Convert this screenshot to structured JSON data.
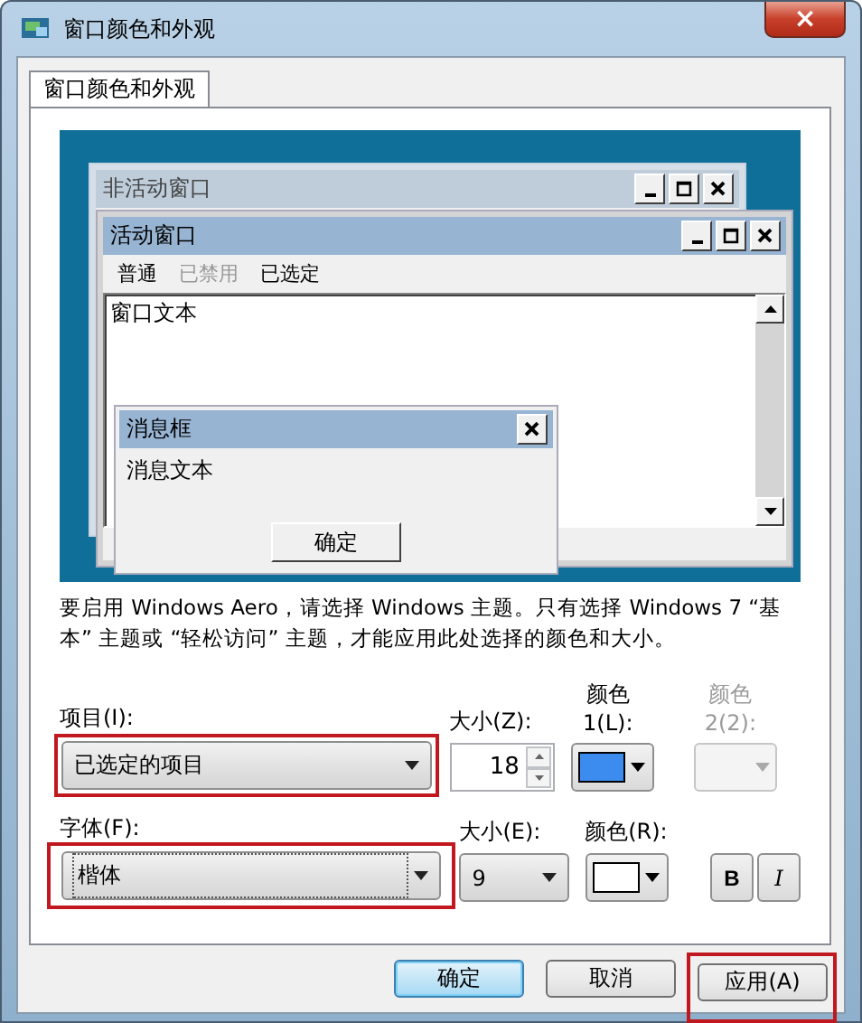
{
  "window": {
    "title": "窗口颜色和外观",
    "close": "×"
  },
  "tabs": [
    {
      "label": "窗口颜色和外观",
      "selected": true
    }
  ],
  "preview": {
    "inactive_window": {
      "title": "非活动窗口"
    },
    "active_window": {
      "title": "活动窗口",
      "menu": [
        {
          "label": "普通",
          "kind": "normal"
        },
        {
          "label": "已禁用",
          "kind": "disabled"
        },
        {
          "label": "已选定",
          "kind": "selected"
        }
      ],
      "text": "窗口文本"
    },
    "message_box": {
      "title": "消息框",
      "text": "消息文本",
      "button": "确定"
    }
  },
  "notice": "要启用 Windows Aero，请选择 Windows 主题。只有选择 Windows 7 “基本” 主题或 “轻松访问” 主题，才能应用此处选择的颜色和大小。",
  "item_row": {
    "item_label": "项目(I):",
    "item_value": "已选定的项目",
    "item_highlighted": true,
    "size_label": "大小(Z):",
    "size_value": "18",
    "color1_label": "颜色 1(L):",
    "color1_swatch": {
      "color": "#3c8cf0"
    },
    "color2_label": "颜色 2(2):",
    "color2_disabled": true
  },
  "font_row": {
    "font_label": "字体(F):",
    "font_value": "楷体",
    "font_highlighted": true,
    "size_label": "大小(E):",
    "size_value": "9",
    "color_label": "颜色(R):",
    "color_swatch": {
      "color": "#ffffff"
    },
    "bold": "B",
    "italic": "I"
  },
  "buttons": [
    {
      "label": "确定",
      "default": true,
      "highlighted": false
    },
    {
      "label": "取消",
      "default": false,
      "highlighted": false
    },
    {
      "label": "应用(A)",
      "default": false,
      "highlighted": true
    }
  ]
}
